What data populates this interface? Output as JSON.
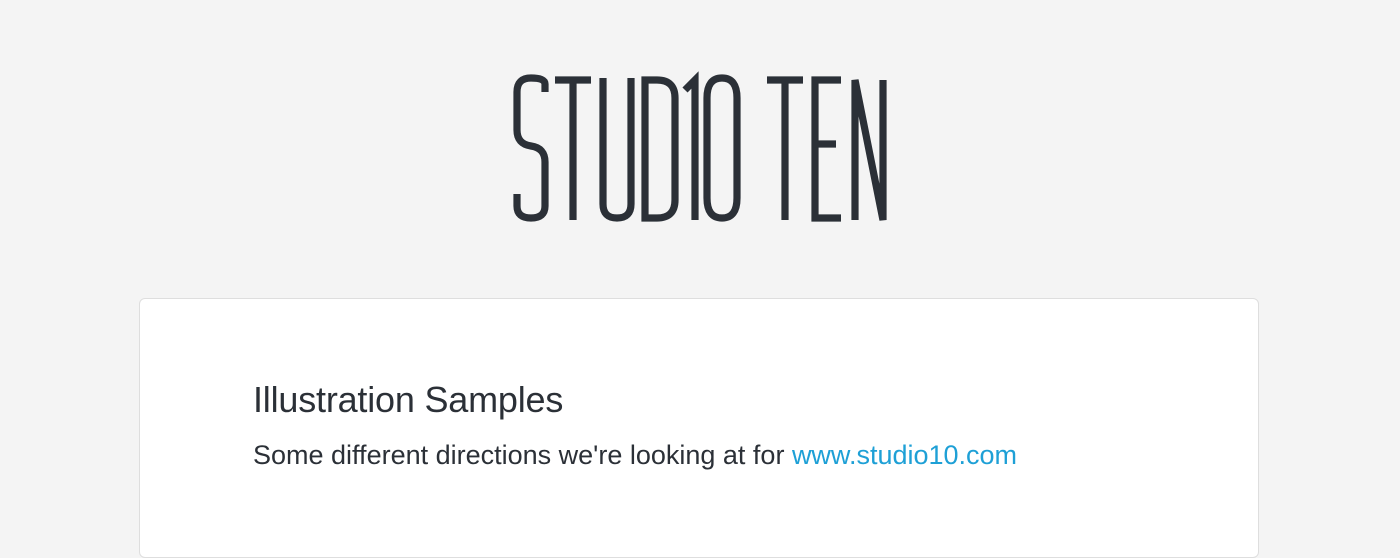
{
  "header": {
    "logo_text": "STUDIO TEN"
  },
  "card": {
    "title": "Illustration Samples",
    "subtitle_prefix": "Some different directions we're looking at for ",
    "link_text": "www.studio10.com"
  },
  "colors": {
    "background": "#f4f4f4",
    "card": "#ffffff",
    "text": "#2b3037",
    "link": "#1ea0d6"
  }
}
